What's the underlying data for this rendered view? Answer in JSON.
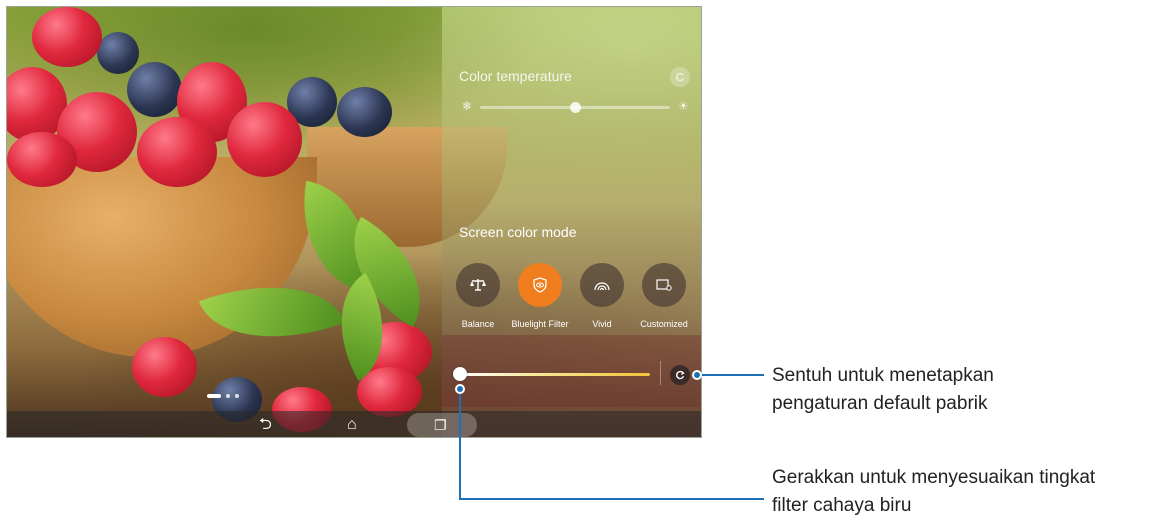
{
  "color_temperature": {
    "title": "Color temperature",
    "cold_icon": "snowflake-icon",
    "warm_icon": "sun-icon",
    "level": 0.5
  },
  "screen_color_mode": {
    "title": "Screen color mode",
    "modes": [
      {
        "label": "Balance",
        "icon": "balance-scale-icon",
        "active": false
      },
      {
        "label": "Bluelight Filter",
        "icon": "eye-shield-icon",
        "active": true
      },
      {
        "label": "Vivid",
        "icon": "rainbow-icon",
        "active": false
      },
      {
        "label": "Customized",
        "icon": "customize-screen-icon",
        "active": false
      }
    ]
  },
  "bluelight_level": 0.0,
  "callouts": {
    "reset": "Sentuh untuk menetapkan\npengaturan default pabrik",
    "slider": "Gerakkan untuk menyesuaikan tingkat\nfilter cahaya biru"
  },
  "colors": {
    "accent_orange": "#f07d1e",
    "callout_blue": "#1d6fb8"
  }
}
